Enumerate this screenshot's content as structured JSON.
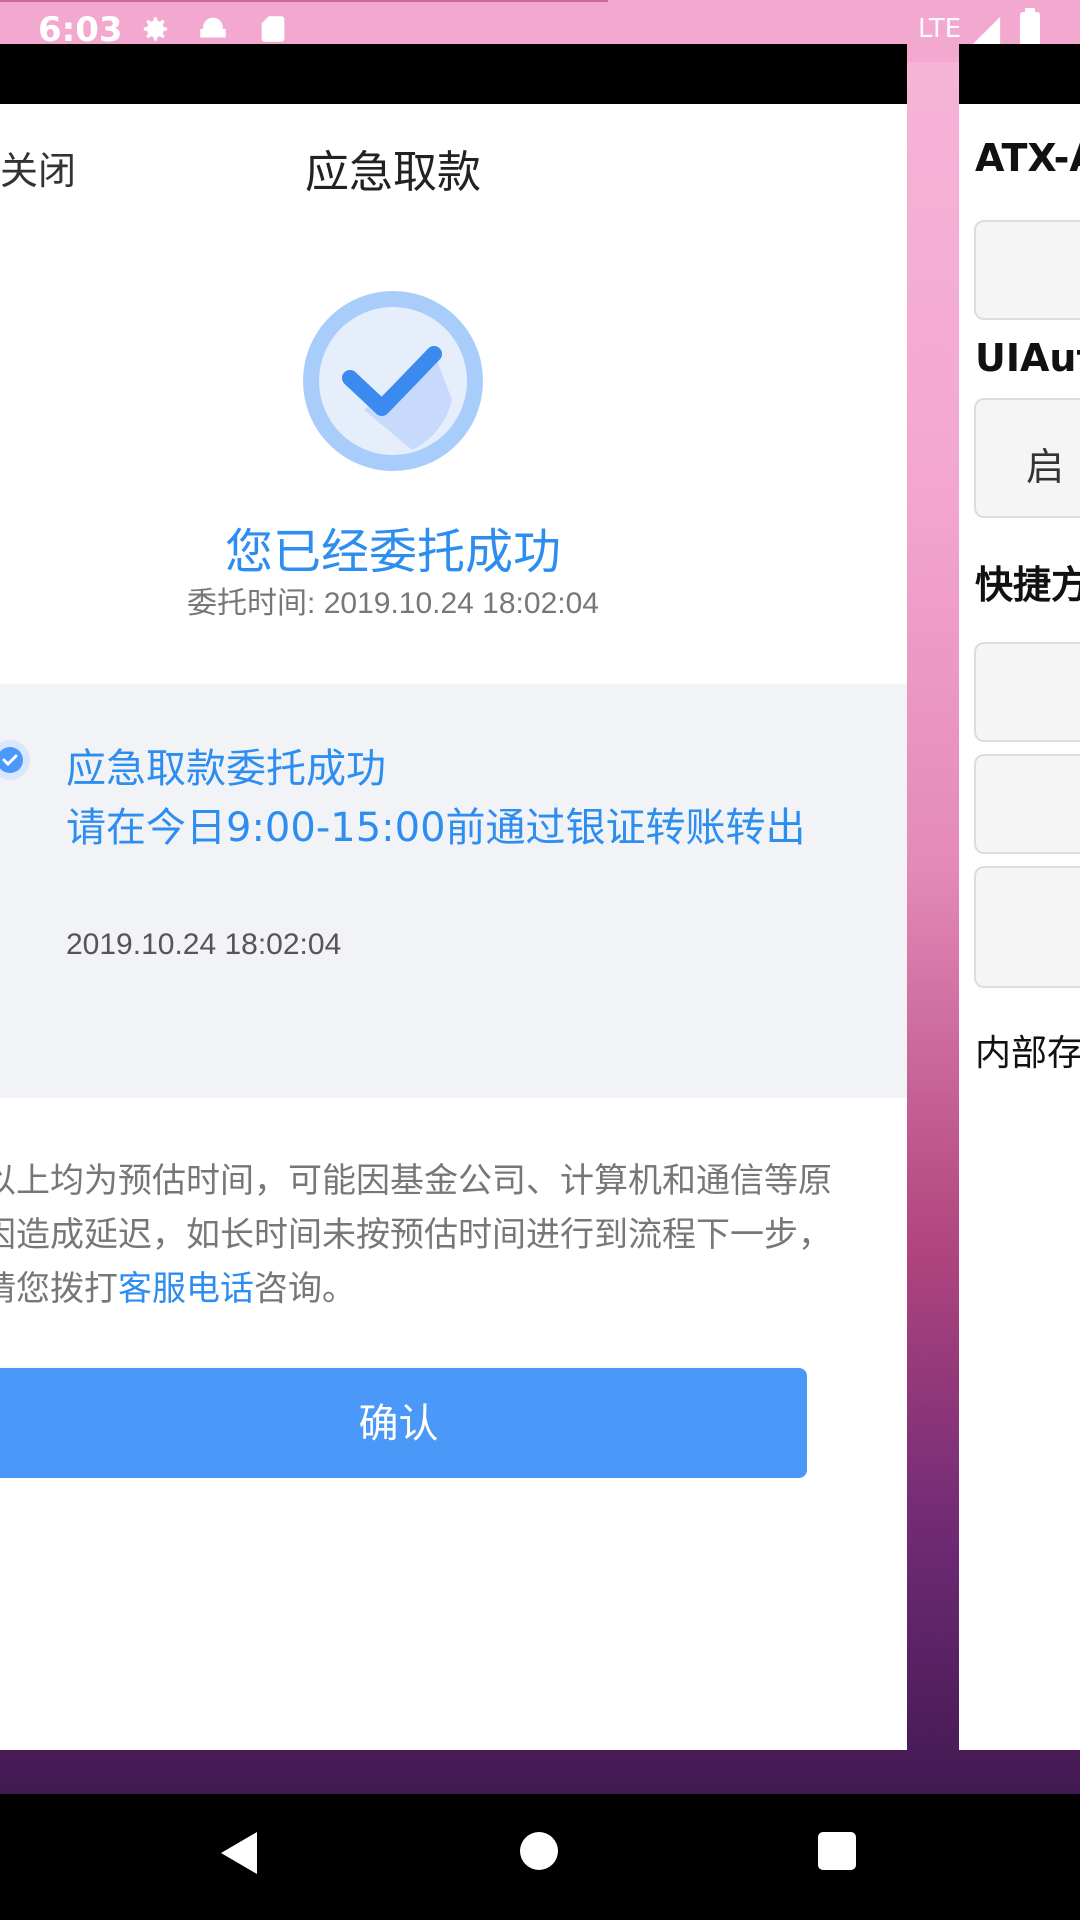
{
  "status_bar": {
    "time": "6:03",
    "network": "LTE"
  },
  "main": {
    "close_label": "关闭",
    "title": "应急取款",
    "success_title": "您已经委托成功",
    "success_time": "委托时间: 2019.10.24 18:02:04",
    "step": {
      "title": "应急取款委托成功",
      "description": "请在今日9:00-15:00前通过银证转账转出",
      "time": "2019.10.24 18:02:04"
    },
    "note_text_1": "以上均为预估时间，可能因基金公司、计算机和通信等原因造成延迟，如长时间未按预估时间进行到流程下一步，请您拨打",
    "note_link": "客服电话",
    "note_text_2": "咨询。",
    "confirm_label": "确认"
  },
  "right_app": {
    "title": "ATX-A",
    "button1": "",
    "section1": "UIAuto",
    "button2": "启",
    "section2": "快捷方",
    "storage_label": "内部存"
  },
  "colors": {
    "accent": "#2d8ef0",
    "button": "#4a98f8"
  }
}
